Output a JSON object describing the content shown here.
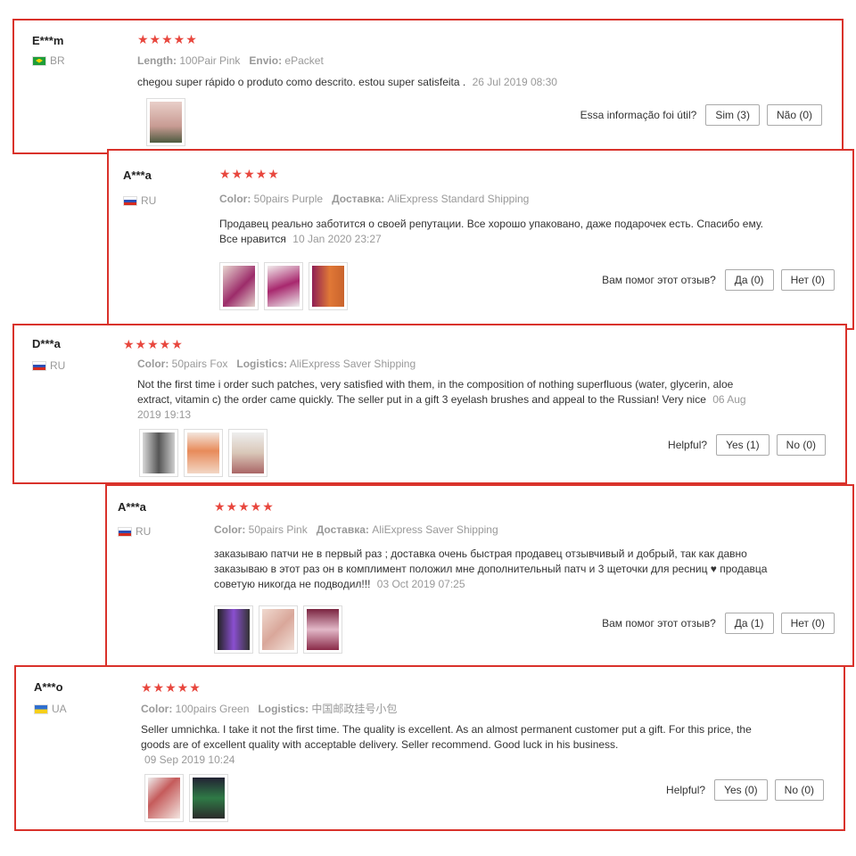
{
  "reviews": [
    {
      "user": "E***m",
      "country": "BR",
      "stars": "★★★★★",
      "attr1_label": "Length:",
      "attr1_value": "100Pair Pink",
      "attr2_label": "Envio:",
      "attr2_value": "ePacket",
      "text": "chegou super rápido o produto como descrito. estou super satisfeita .",
      "date": "26 Jul 2019 08:30",
      "helpful_q": "Essa informação foi útil?",
      "yes": "Sim (3)",
      "no": "Não (0)"
    },
    {
      "user": "A***a",
      "country": "RU",
      "stars": "★★★★★",
      "attr1_label": "Color:",
      "attr1_value": "50pairs Purple",
      "attr2_label": "Доставка:",
      "attr2_value": "AliExpress Standard Shipping",
      "text": "Продавец реально заботится о своей репутации. Все хорошо упаковано, даже подарочек есть. Спасибо ему. Все нравится",
      "date": "10 Jan 2020 23:27",
      "helpful_q": "Вам помог этот отзыв?",
      "yes": "Да (0)",
      "no": "Нет (0)"
    },
    {
      "user": "D***a",
      "country": "RU",
      "stars": "★★★★★",
      "attr1_label": "Color:",
      "attr1_value": "50pairs Fox",
      "attr2_label": "Logistics:",
      "attr2_value": "AliExpress Saver Shipping",
      "text": "Not the first time i order such patches, very satisfied with them, in the composition of nothing superfluous (water, glycerin, aloe extract, vitamin c) the order came quickly. The seller put in a gift 3 eyelash brushes and appeal to the Russian! Very nice",
      "date": "06 Aug 2019 19:13",
      "helpful_q": "Helpful?",
      "yes": "Yes (1)",
      "no": "No (0)"
    },
    {
      "user": "A***a",
      "country": "RU",
      "stars": "★★★★★",
      "attr1_label": "Color:",
      "attr1_value": "50pairs Pink",
      "attr2_label": "Доставка:",
      "attr2_value": "AliExpress Saver Shipping",
      "text": "заказываю патчи не в первый раз ; доставка очень быстрая продавец отзывчивый и добрый, так как давно заказываю в этот раз он в комплимент положил мне дополнительный патч и 3 щеточки для ресниц ♥ продавца советую никогда не подводил!!!",
      "date": "03 Oct 2019 07:25",
      "helpful_q": "Вам помог этот отзыв?",
      "yes": "Да (1)",
      "no": "Нет (0)"
    },
    {
      "user": "A***o",
      "country": "UA",
      "stars": "★★★★★",
      "attr1_label": "Color:",
      "attr1_value": "100pairs Green",
      "attr2_label": "Logistics:",
      "attr2_value": "中国邮政挂号小包",
      "text": "Seller umnichka. I take it not the first time. The quality is excellent. As an almost permanent customer put a gift. For this price, the goods are of excellent quality with acceptable delivery. Seller recommend. Good luck in his business.",
      "date": "09 Sep 2019 10:24",
      "helpful_q": "Helpful?",
      "yes": "Yes (0)",
      "no": "No (0)"
    }
  ],
  "colors": {
    "highlight_border": "#d9322b",
    "star": "#e8473e"
  }
}
